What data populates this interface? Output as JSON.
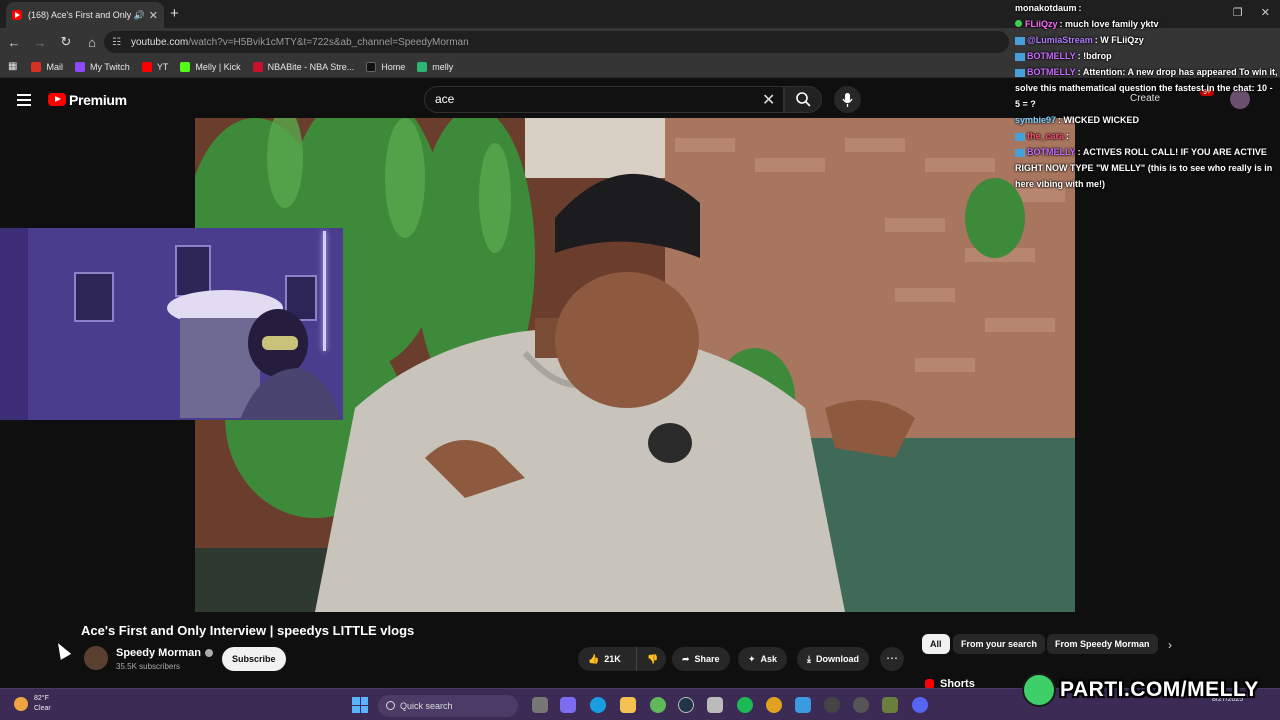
{
  "browser": {
    "tab_title": "(168) Ace's First and Only Ir",
    "url_host": "youtube.com",
    "url_rest": "/watch?v=H5Bvik1cMTY&t=722s&ab_channel=SpeedyMorman",
    "bookmarks": [
      {
        "label": "Mail",
        "color": "#d93025"
      },
      {
        "label": "My Twitch",
        "color": "#9146ff"
      },
      {
        "label": "YT",
        "color": "#ff0000"
      },
      {
        "label": "Melly | Kick",
        "color": "#53fc18"
      },
      {
        "label": "NBABite - NBA Stre...",
        "color": "#c8102e"
      },
      {
        "label": "Home",
        "color": "#111111"
      },
      {
        "label": "melly",
        "color": "#2bb673"
      }
    ]
  },
  "youtube": {
    "brand": "Premium",
    "search_query": "ace",
    "create_label": "Create",
    "notif_count": "9+",
    "video_title": "Ace's First and Only Interview | speedys LITTLE vlogs",
    "channel_name": "Speedy Morman",
    "subscribers": "35.5K subscribers",
    "subscribe_label": "Subscribe",
    "likes": "21K",
    "share_label": "Share",
    "ask_label": "Ask",
    "download_label": "Download",
    "chips": [
      "All",
      "From your search",
      "From Speedy Morman"
    ],
    "shorts_label": "Shorts",
    "colors": {
      "brand_red": "#ff0000",
      "bg": "#0f0f0f"
    }
  },
  "chat": [
    {
      "user": "monakotdaum",
      "text": ":",
      "color": "#ffffff"
    },
    {
      "user": "FLiiQzy",
      "text": ": much love family yktv",
      "color": "#ff66ff"
    },
    {
      "user": "@LumiaStream",
      "text": ": W FLiiQzy",
      "color": "#b07cff"
    },
    {
      "user": "BOTMELLY",
      "text": ": !bdrop",
      "color": "#c46bff"
    },
    {
      "user": "BOTMELLY",
      "text": ": Attention: A new drop has appeared To win it, solve this mathematical question the fastest in the chat: 10 - 5 = ?",
      "color": "#c46bff"
    },
    {
      "user": "symbie97",
      "text": ": WICKED WICKED",
      "color": "#7bd3ff"
    },
    {
      "user": "the_cara",
      "text": ":",
      "color": "#ff4d6d"
    },
    {
      "user": "BOTMELLY",
      "text": ": ACTIVES ROLL CALL! IF YOU ARE ACTIVE RIGHT NOW TYPE \"W MELLY\" (this is to see who really is in here vibing with me!)",
      "color": "#c46bff"
    }
  ],
  "taskbar": {
    "temp": "82°F",
    "condition": "Clear",
    "search_placeholder": "Quick search",
    "date": "8/27/2025"
  },
  "overlay": {
    "banner_text": "PARTI.COM/MELLY"
  }
}
